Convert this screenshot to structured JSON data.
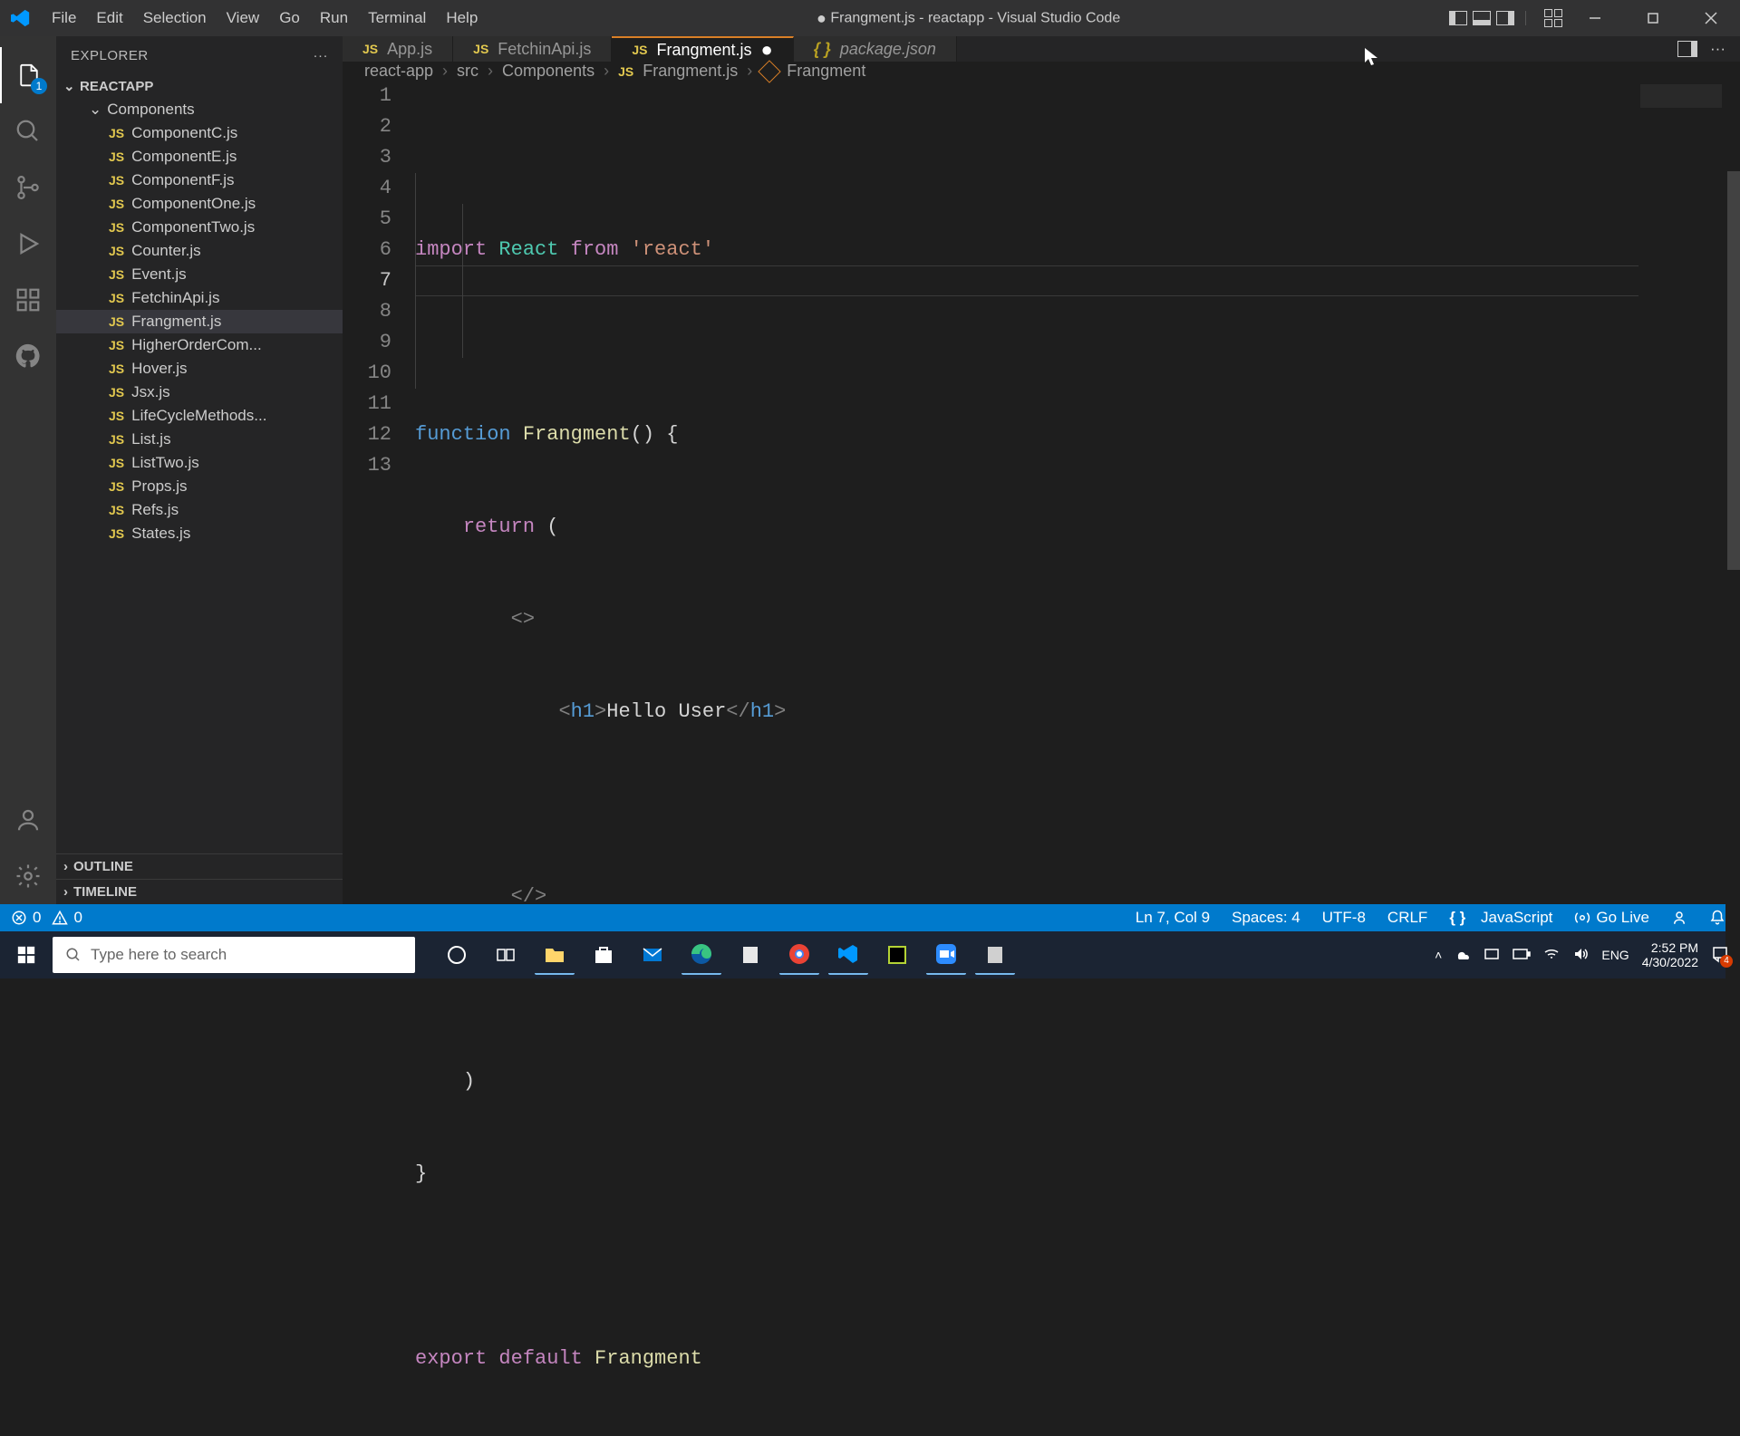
{
  "menu": [
    "File",
    "Edit",
    "Selection",
    "View",
    "Go",
    "Run",
    "Terminal",
    "Help"
  ],
  "window_title": "Frangment.js - reactapp - Visual Studio Code",
  "explorer": {
    "title": "EXPLORER",
    "project": "REACTAPP",
    "folder": "Components",
    "files": [
      "ComponentC.js",
      "ComponentE.js",
      "ComponentF.js",
      "ComponentOne.js",
      "ComponentTwo.js",
      "Counter.js",
      "Event.js",
      "FetchinApi.js",
      "Frangment.js",
      "HigherOrderCom...",
      "Hover.js",
      "Jsx.js",
      "LifeCycleMethods...",
      "List.js",
      "ListTwo.js",
      "Props.js",
      "Refs.js",
      "States.js"
    ],
    "outline": "OUTLINE",
    "timeline": "TIMELINE"
  },
  "tabs": [
    {
      "label": "App.js",
      "icon": "js"
    },
    {
      "label": "FetchinApi.js",
      "icon": "js"
    },
    {
      "label": "Frangment.js",
      "icon": "js",
      "active": true,
      "dirty": true
    },
    {
      "label": "package.json",
      "icon": "braces",
      "italic": true
    }
  ],
  "breadcrumbs": [
    "react-app",
    "src",
    "Components",
    "Frangment.js",
    "Frangment"
  ],
  "code": {
    "line1_import": "import",
    "line1_react": "React",
    "line1_from": "from",
    "line1_str": "'react'",
    "line3_func": "function",
    "line3_name": "Frangment",
    "line3_paren": "() {",
    "line4_return": "return",
    "line4_paren": "(",
    "line5_frag": "<>",
    "line6_open": "<",
    "line6_tag1": "h1",
    "line6_close1": ">",
    "line6_text": "Hello User",
    "line6_open2": "</",
    "line6_tag2": "h1",
    "line6_close2": ">",
    "line8_frag": "</>",
    "line10_paren": ")",
    "line11_brace": "}",
    "line13_export": "export",
    "line13_default": "default",
    "line13_name": "Frangment"
  },
  "status": {
    "errors": "0",
    "warnings": "0",
    "cursor": "Ln 7, Col 9",
    "spaces": "Spaces: 4",
    "encoding": "UTF-8",
    "eol": "CRLF",
    "lang": "JavaScript",
    "golive": "Go Live"
  },
  "search_placeholder": "Type here to search",
  "tray": {
    "lang": "ENG",
    "time": "2:52 PM",
    "date": "4/30/2022",
    "badge": "4"
  },
  "act_badge": "1"
}
